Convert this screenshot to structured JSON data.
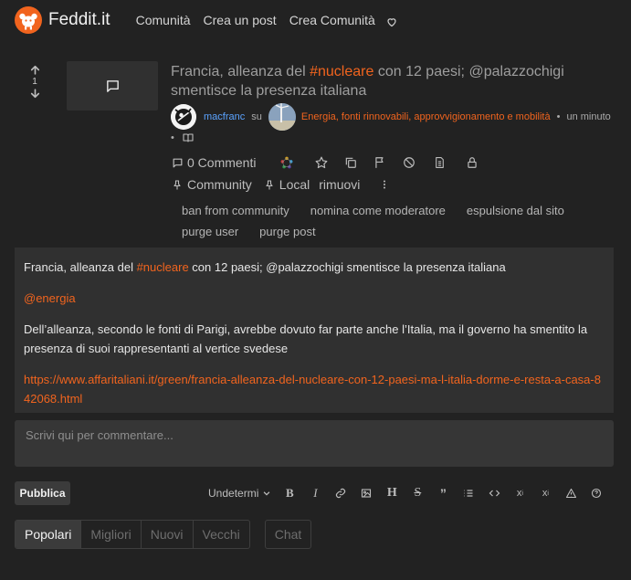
{
  "nav": {
    "brand": "Feddit.it",
    "links": [
      "Comunità",
      "Crea un post",
      "Crea Comunità"
    ]
  },
  "post": {
    "score": "1",
    "title_before": "Francia, alleanza del ",
    "title_hashtag": "#nucleare",
    "title_after": " con 12 paesi; @palazzochigi smentisce la presenza italiana",
    "author": "macfranc",
    "on_word": "su",
    "community": "Energia, fonti rinnovabili, approvvigionamento e mobilità",
    "time": "un minuto",
    "comments_label": "0 Commenti",
    "community_btn": "Community",
    "local_btn": "Local",
    "remove_btn": "rimuovi",
    "mod_actions_row1": [
      "ban from community",
      "nomina come moderatore",
      "espulsione dal sito"
    ],
    "mod_actions_row2": [
      "purge user",
      "purge post"
    ]
  },
  "body": {
    "line1_before": "Francia, alleanza del ",
    "line1_hashtag": "#nucleare",
    "line1_after": " con 12 paesi; @palazzochigi smentisce la presenza italiana",
    "mention": "@energia",
    "paragraph": "Dell’alleanza, secondo le fonti di Parigi, avrebbe dovuto far parte anche l’Italia, ma il governo ha smentito la presenza di suoi rappresentanti al vertice svedese",
    "link": "https://www.affaritaliani.it/green/francia-alleanza-del-nucleare-con-12-paesi-ma-l-italia-dorme-e-resta-a-casa-842068.html"
  },
  "editor": {
    "placeholder": "Scrivi qui per commentare...",
    "publish_label": "Pubblica",
    "language": "Undetermi"
  },
  "sort": {
    "tabs": [
      "Popolari",
      "Migliori",
      "Nuovi",
      "Vecchi"
    ],
    "active": "Popolari",
    "chat": "Chat"
  },
  "colors": {
    "background": "#222222",
    "card": "#303030",
    "accent": "#f1641e",
    "user_link": "#5ba3ff"
  }
}
